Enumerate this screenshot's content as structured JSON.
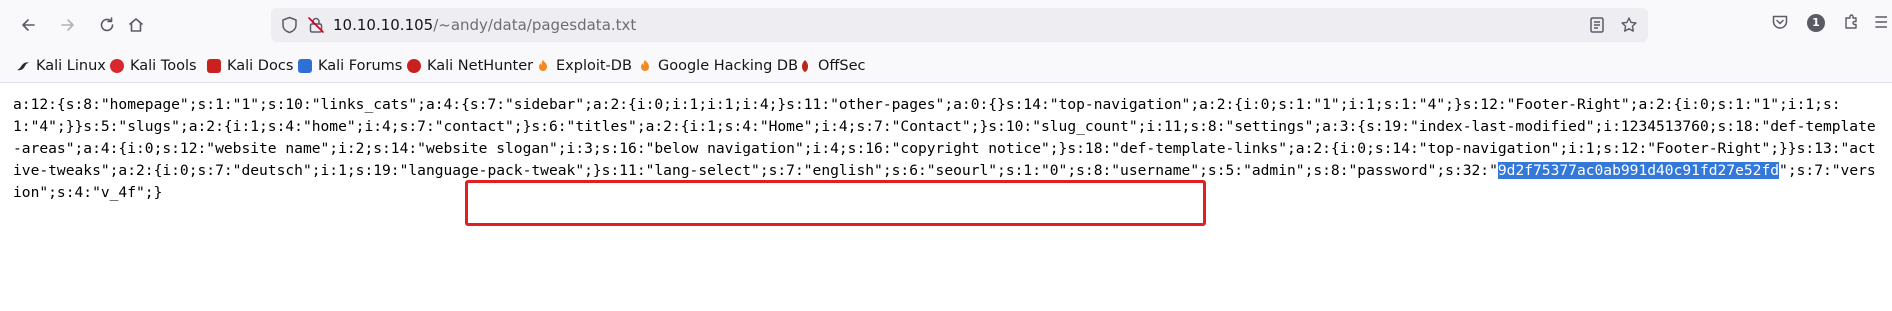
{
  "browser": {
    "url_host": "10.10.10.105",
    "url_path": "/~andy/data/pagesdata.txt",
    "notification_badge": "1"
  },
  "bookmarks": [
    {
      "label": "Kali Linux",
      "icon": "kali-dragon-icon",
      "color": "#2b2b2b"
    },
    {
      "label": "Kali Tools",
      "icon": "kali-tools-icon",
      "color": "#d9272e"
    },
    {
      "label": "Kali Docs",
      "icon": "kali-docs-icon",
      "color": "#c9211e"
    },
    {
      "label": "Kali Forums",
      "icon": "kali-forums-icon",
      "color": "#2f6fd6"
    },
    {
      "label": "Kali NetHunter",
      "icon": "nethunter-icon",
      "color": "#c9211e"
    },
    {
      "label": "Exploit-DB",
      "icon": "exploit-db-icon",
      "color": "#f08a24"
    },
    {
      "label": "Google Hacking DB",
      "icon": "ghdb-icon",
      "color": "#f08a24"
    },
    {
      "label": "OffSec",
      "icon": "offsec-icon",
      "color": "#b8281f"
    }
  ],
  "content": {
    "text_before": "a:12:{s:8:\"homepage\";s:1:\"1\";s:10:\"links_cats\";a:4:{s:7:\"sidebar\";a:2:{i:0;i:1;i:1;i:4;}s:11:\"other-pages\";a:0:{}s:14:\"top-navigation\";a:2:{i:0;s:1:\"1\";i:1;s:1:\"4\";}s:12:\"Footer-Right\";a:2:{i:0;s:1:\"1\";i:1;s:1:\"4\";}}s:5:\"slugs\";a:2:{i:1;s:4:\"home\";i:4;s:7:\"contact\";}s:6:\"titles\";a:2:{i:1;s:4:\"Home\";i:4;s:7:\"Contact\";}s:10:\"slug_count\";i:11;s:8:\"settings\";a:3:{s:19:\"index-last-modified\";i:1234513760;s:18:\"def-template-areas\";a:4:{i:0;s:12:\"website name\";i:2;s:14:\"website slogan\";i:3;s:16:\"below navigation\";i:4;s:16:\"copyright notice\";}s:18:\"def-template-links\";a:2:{i:0;s:14:\"top-navigation\";i:1;s:12:\"Footer-Right\";}}s:13:\"active-tweaks\";a:2:{i:0;s:7:\"deutsch\";i:1;s:19:\"language-pack-tweak\";}s:11:\"lang-select\";s:7:\"english\";s:6:\"seourl\";s:1:\"0\";s:8:\"username\";s:5:\"admin\";s:8:\"password\";s:32:\"",
    "selected_hash": "9d2f75377ac0ab991d40c91fd27e52fd",
    "text_after": "\";s:7:\"version\";s:4:\"v_4f\";}"
  },
  "colors": {
    "highlight_box": "#e02020",
    "selection": "#3478d9"
  }
}
